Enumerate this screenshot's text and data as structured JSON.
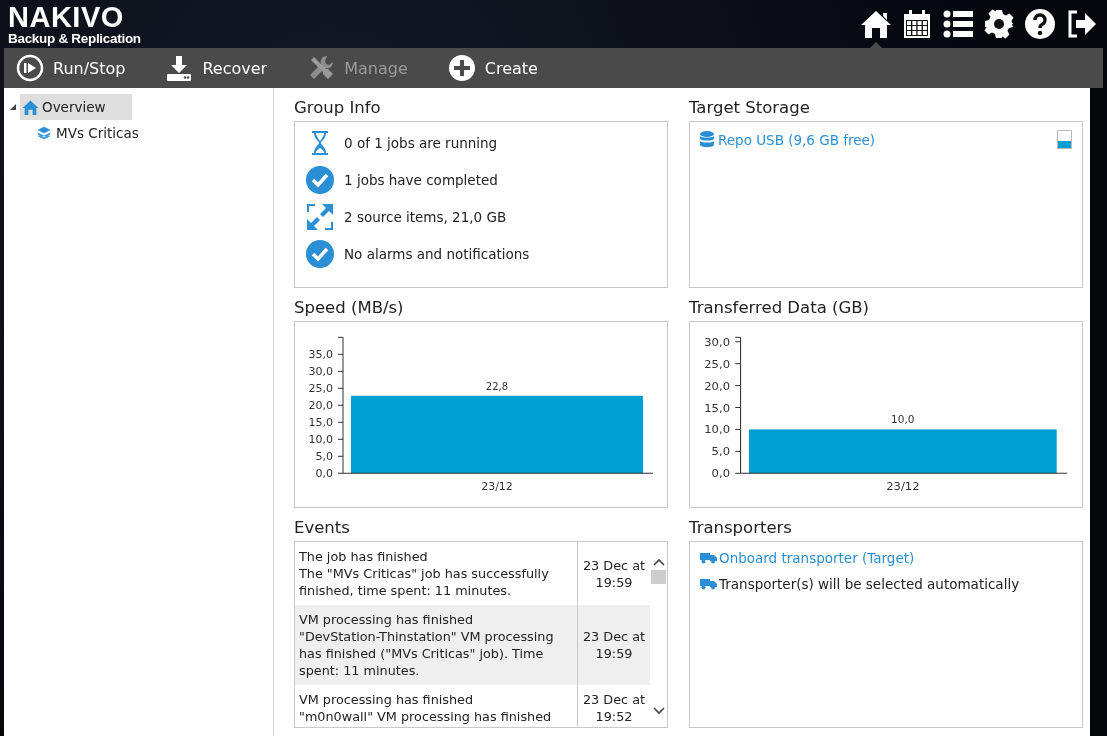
{
  "header": {
    "logo": {
      "title": "NAKIVO",
      "subtitle": "Backup & Replication"
    },
    "nav": [
      {
        "selected": true
      },
      {
        "selected": false
      },
      {
        "selected": false
      },
      {
        "selected": false
      },
      {
        "selected": false
      },
      {
        "selected": false
      }
    ]
  },
  "toolbar": [
    {
      "label": "Run/Stop",
      "disabled": false
    },
    {
      "label": "Recover",
      "disabled": false
    },
    {
      "label": "Manage",
      "disabled": true
    },
    {
      "label": "Create",
      "disabled": false
    }
  ],
  "sidebar": {
    "items": [
      {
        "label": "Overview",
        "selected": true,
        "expanded": true,
        "children": [
          {
            "label": "MVs Criticas",
            "selected": false
          }
        ]
      }
    ]
  },
  "group_info": {
    "title": "Group Info",
    "items": [
      "0 of 1 jobs are running",
      "1 jobs have completed",
      "2 source items, 21,0 GB",
      "No alarms and notifications"
    ]
  },
  "target_storage": {
    "title": "Target Storage",
    "items": [
      {
        "label": "Repo USB (9,6 GB free)",
        "level": 0.4
      }
    ]
  },
  "speed": {
    "title": "Speed (MB/s)",
    "chart_data": {
      "type": "bar",
      "categories": [
        "23/12"
      ],
      "values": [
        22.8
      ],
      "ylim": [
        0,
        40
      ],
      "yticks": [
        {
          "value": 0,
          "label": "0,0"
        },
        {
          "value": 5,
          "label": "5,0"
        },
        {
          "value": 10,
          "label": "10,0"
        },
        {
          "value": 15,
          "label": "15,0"
        },
        {
          "value": 20,
          "label": "20,0"
        },
        {
          "value": 25,
          "label": "25,0"
        },
        {
          "value": 30,
          "label": "30,0"
        },
        {
          "value": 35,
          "label": "35,0"
        }
      ],
      "value_labels": [
        "22,8"
      ]
    }
  },
  "transferred": {
    "title": "Transferred Data (GB)",
    "chart_data": {
      "type": "bar",
      "categories": [
        "23/12"
      ],
      "values": [
        10.0
      ],
      "ylim": [
        0,
        31
      ],
      "yticks": [
        {
          "value": 0,
          "label": "0,0"
        },
        {
          "value": 5,
          "label": "5,0"
        },
        {
          "value": 10,
          "label": "10,0"
        },
        {
          "value": 15,
          "label": "15,0"
        },
        {
          "value": 20,
          "label": "20,0"
        },
        {
          "value": 25,
          "label": "25,0"
        },
        {
          "value": 30,
          "label": "30,0"
        }
      ],
      "value_labels": [
        "10,0"
      ]
    }
  },
  "events": {
    "title": "Events",
    "rows": [
      {
        "title": "The job has finished",
        "message": "The \"MVs Criticas\" job has successfully finished, time spent: 11 minutes.",
        "date": "23 Dec at",
        "time": "19:59"
      },
      {
        "title": "VM processing has finished",
        "message": "\"DevStation-Thinstation\" VM processing has finished (\"MVs Criticas\" job). Time spent: 11 minutes.",
        "date": "23 Dec at",
        "time": "19:59"
      },
      {
        "title": "VM processing has finished",
        "message": "\"m0n0wall\" VM processing has finished",
        "date": "23 Dec at",
        "time": "19:52"
      }
    ]
  },
  "transporters": {
    "title": "Transporters",
    "items": [
      {
        "label": "Onboard transporter (Target)",
        "kind": "link"
      },
      {
        "label": "Transporter(s) will be selected automatically",
        "kind": "text"
      }
    ]
  }
}
